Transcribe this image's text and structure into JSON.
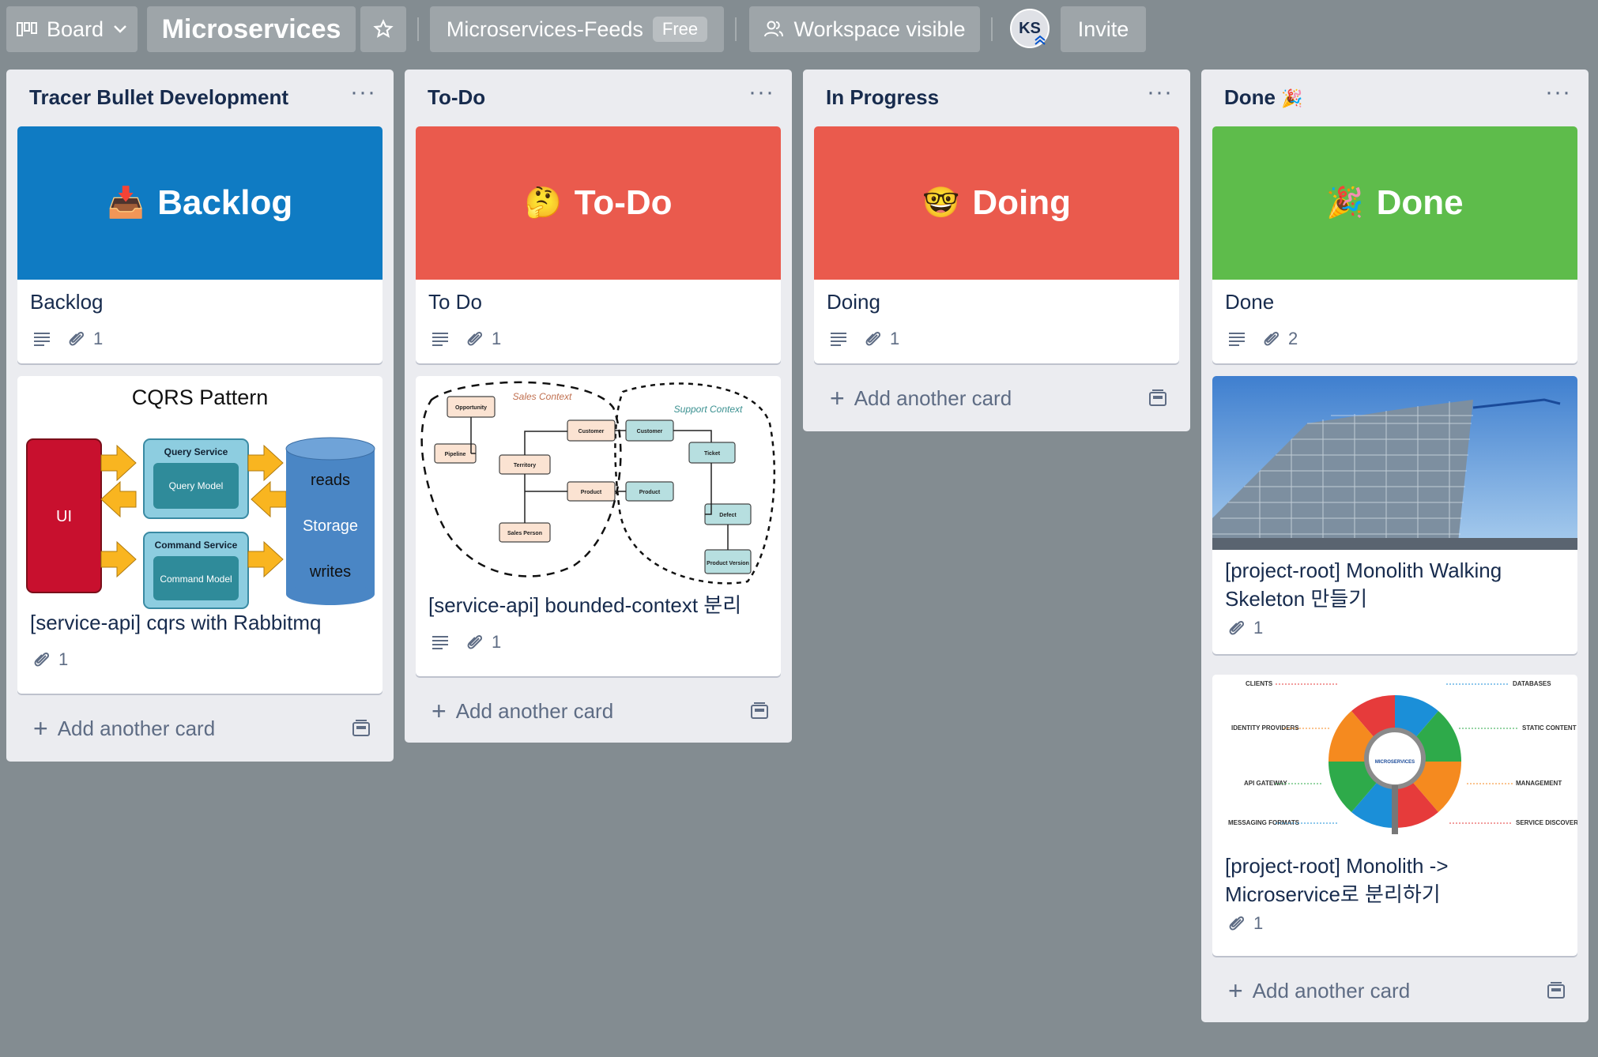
{
  "topbar": {
    "board_switcher": "Board",
    "board_name": "Microservices",
    "workspace": "Microservices-Feeds",
    "workspace_badge": "Free",
    "visibility": "Workspace visible",
    "avatar_initials": "KS",
    "invite": "Invite"
  },
  "lists": [
    {
      "title": "Tracer Bullet Development",
      "cards": [
        {
          "cover_title": "Backlog",
          "title": "Backlog",
          "attachments": "1"
        },
        {
          "image_title": "CQRS Pattern",
          "title": "[service-api] cqrs with Rabbitmq",
          "attachments": "1",
          "diagram": {
            "ui": "UI",
            "query_service": "Query Service",
            "query_model": "Query Model",
            "command_service": "Command Service",
            "command_model": "Command Model",
            "reads": "reads",
            "storage": "Storage",
            "writes": "writes"
          }
        }
      ],
      "add_card": "Add another card"
    },
    {
      "title": "To-Do",
      "cards": [
        {
          "cover_title": "To-Do",
          "title": "To Do",
          "attachments": "1"
        },
        {
          "title": "[service-api] bounded-context 분리",
          "attachments": "1",
          "diagram": {
            "sales_context": "Sales Context",
            "support_context": "Support Context",
            "opportunity": "Opportunity",
            "pipeline": "Pipeline",
            "territory": "Territory",
            "customer": "Customer",
            "product": "Product",
            "sales_person": "Sales Person",
            "customer2": "Customer",
            "product2": "Product",
            "ticket": "Ticket",
            "defect": "Defect",
            "product_version": "Product Version"
          }
        }
      ],
      "add_card": "Add another card"
    },
    {
      "title": "In Progress",
      "cards": [
        {
          "cover_title": "Doing",
          "title": "Doing",
          "attachments": "1"
        }
      ],
      "add_card": "Add another card"
    },
    {
      "title": "Done",
      "cards": [
        {
          "cover_title": "Done",
          "title": "Done",
          "attachments": "2"
        },
        {
          "title_line1": "[project-root] Monolith Walking",
          "title_line2": "Skeleton 만들기",
          "attachments": "1"
        },
        {
          "title_line1": "[project-root] Monolith ->",
          "title_line2": "Microservice로 분리하기",
          "attachments": "1",
          "diagram": {
            "center": "MICROSERVICES",
            "clients": "CLIENTS",
            "identity": "IDENTITY PROVIDERS",
            "api": "API GATEWAY",
            "messaging": "MESSAGING FORMATS",
            "databases": "DATABASES",
            "static": "STATIC CONTENT",
            "management": "MANAGEMENT",
            "discovery": "SERVICE DISCOVERY"
          }
        }
      ],
      "add_card": "Add another card"
    }
  ],
  "colors": {
    "blue": "#0f7bc3",
    "red": "#ea5a4d",
    "green": "#5ebc4b"
  }
}
